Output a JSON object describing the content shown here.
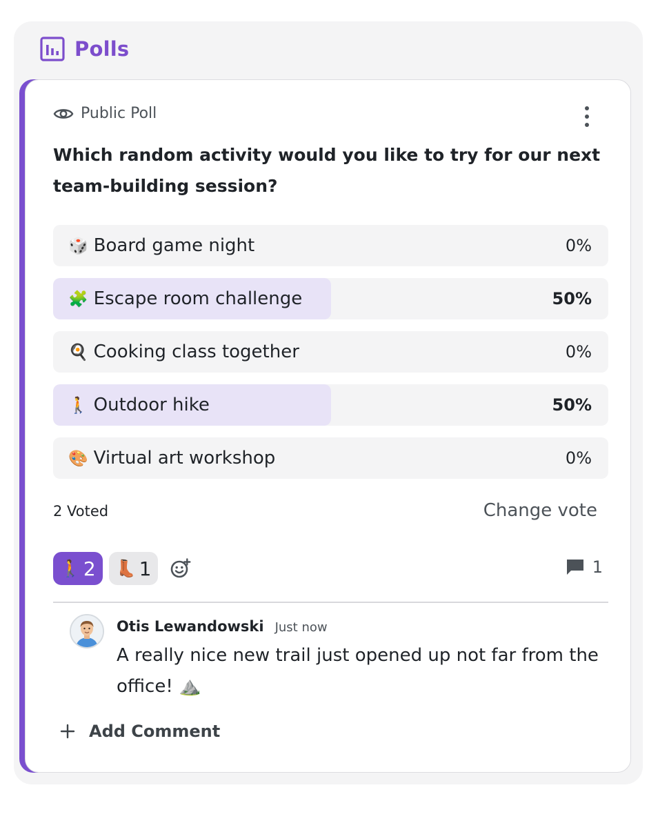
{
  "header": {
    "title": "Polls",
    "icon": "bar-chart-icon",
    "accent": "#7c4dcc"
  },
  "poll": {
    "visibility_label": "Public Poll",
    "visibility_icon": "eye-icon",
    "question": "Which random activity would you like to try for our next team-building session?",
    "options": [
      {
        "emoji": "🎲",
        "label": "Board game night",
        "percent_text": "0%",
        "percent": 0
      },
      {
        "emoji": "🧩",
        "label": "Escape room challenge",
        "percent_text": "50%",
        "percent": 50
      },
      {
        "emoji": "🍳",
        "label": "Cooking class together",
        "percent_text": "0%",
        "percent": 0
      },
      {
        "emoji": "🚶",
        "label": "Outdoor hike",
        "percent_text": "50%",
        "percent": 50
      },
      {
        "emoji": "🎨",
        "label": "Virtual art workshop",
        "percent_text": "0%",
        "percent": 0
      }
    ],
    "voted_text": "2 Voted",
    "change_vote_label": "Change vote",
    "reactions": [
      {
        "emoji": "🚶",
        "count": "2",
        "active": true
      },
      {
        "emoji": "👢",
        "count": "1",
        "active": false
      }
    ],
    "comment_count": "1",
    "comment": {
      "author": "Otis Lewandowski",
      "time": "Just now",
      "text": "A really nice new trail just opened up not far from the office! ⛰️"
    },
    "add_comment_label": "Add Comment"
  },
  "colors": {
    "card_accent": "#7a4fcf",
    "option_fill": "#e8e3f7",
    "panel_bg": "#f4f4f5"
  }
}
